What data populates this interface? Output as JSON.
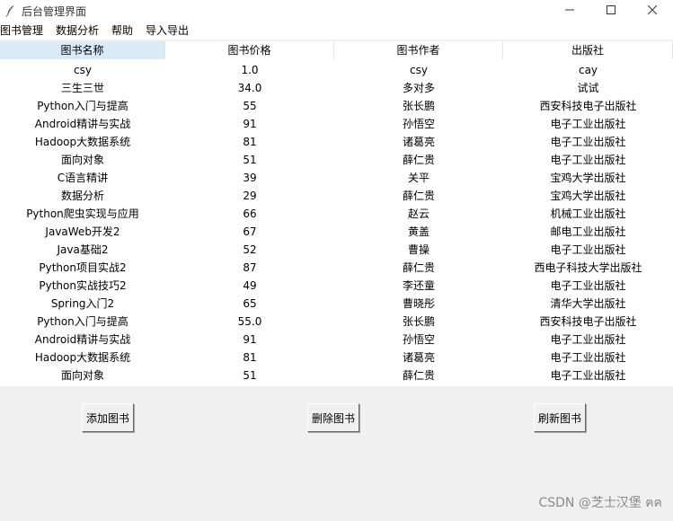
{
  "window": {
    "title": "后台管理界面",
    "app_icon": "feather-icon",
    "controls": [
      "minimize-icon",
      "maximize-icon",
      "close-icon"
    ]
  },
  "menu": [
    "图书管理",
    "数据分析",
    "帮助",
    "导入导出"
  ],
  "table": {
    "columns": [
      "图书名称",
      "图书价格",
      "图书作者",
      "出版社"
    ],
    "rows": [
      [
        "csy",
        "1.0",
        "csy",
        "cay"
      ],
      [
        "三生三世",
        "34.0",
        "多对多",
        "试试"
      ],
      [
        "Python入门与提高",
        "55",
        "张长鹏",
        "西安科技电子出版社"
      ],
      [
        "Android精讲与实战",
        "91",
        "孙悟空",
        "电子工业出版社"
      ],
      [
        "Hadoop大数据系统",
        "81",
        "诸葛亮",
        "电子工业出版社"
      ],
      [
        "面向对象",
        "51",
        "薛仁贵",
        "电子工业出版社"
      ],
      [
        "C语言精讲",
        "39",
        "关平",
        "宝鸡大学出版社"
      ],
      [
        "数据分析",
        "29",
        "薛仁贵",
        "宝鸡大学出版社"
      ],
      [
        "Python爬虫实现与应用",
        "66",
        "赵云",
        "机械工业出版社"
      ],
      [
        "JavaWeb开发2",
        "67",
        "黄盖",
        "邮电工业出版社"
      ],
      [
        "Java基础2",
        "52",
        "曹操",
        "电子工业出版社"
      ],
      [
        "Python项目实战2",
        "87",
        "薛仁贵",
        "西电子科技大学出版社"
      ],
      [
        "Python实战技巧2",
        "49",
        "李还童",
        "电子工业出版社"
      ],
      [
        "Spring入门2",
        "65",
        "曹晓彤",
        "清华大学出版社"
      ],
      [
        "Python入门与提高",
        "55.0",
        "张长鹏",
        "西安科技电子出版社"
      ],
      [
        "Android精讲与实战",
        "91",
        "孙悟空",
        "电子工业出版社"
      ],
      [
        "Hadoop大数据系统",
        "81",
        "诸葛亮",
        "电子工业出版社"
      ],
      [
        "面向对象",
        "51",
        "薛仁贵",
        "电子工业出版社"
      ]
    ]
  },
  "buttons": {
    "add": "添加图书",
    "delete": "删除图书",
    "refresh": "刷新图书"
  },
  "watermark": "CSDN @芝士汉堡 ฅฅ"
}
